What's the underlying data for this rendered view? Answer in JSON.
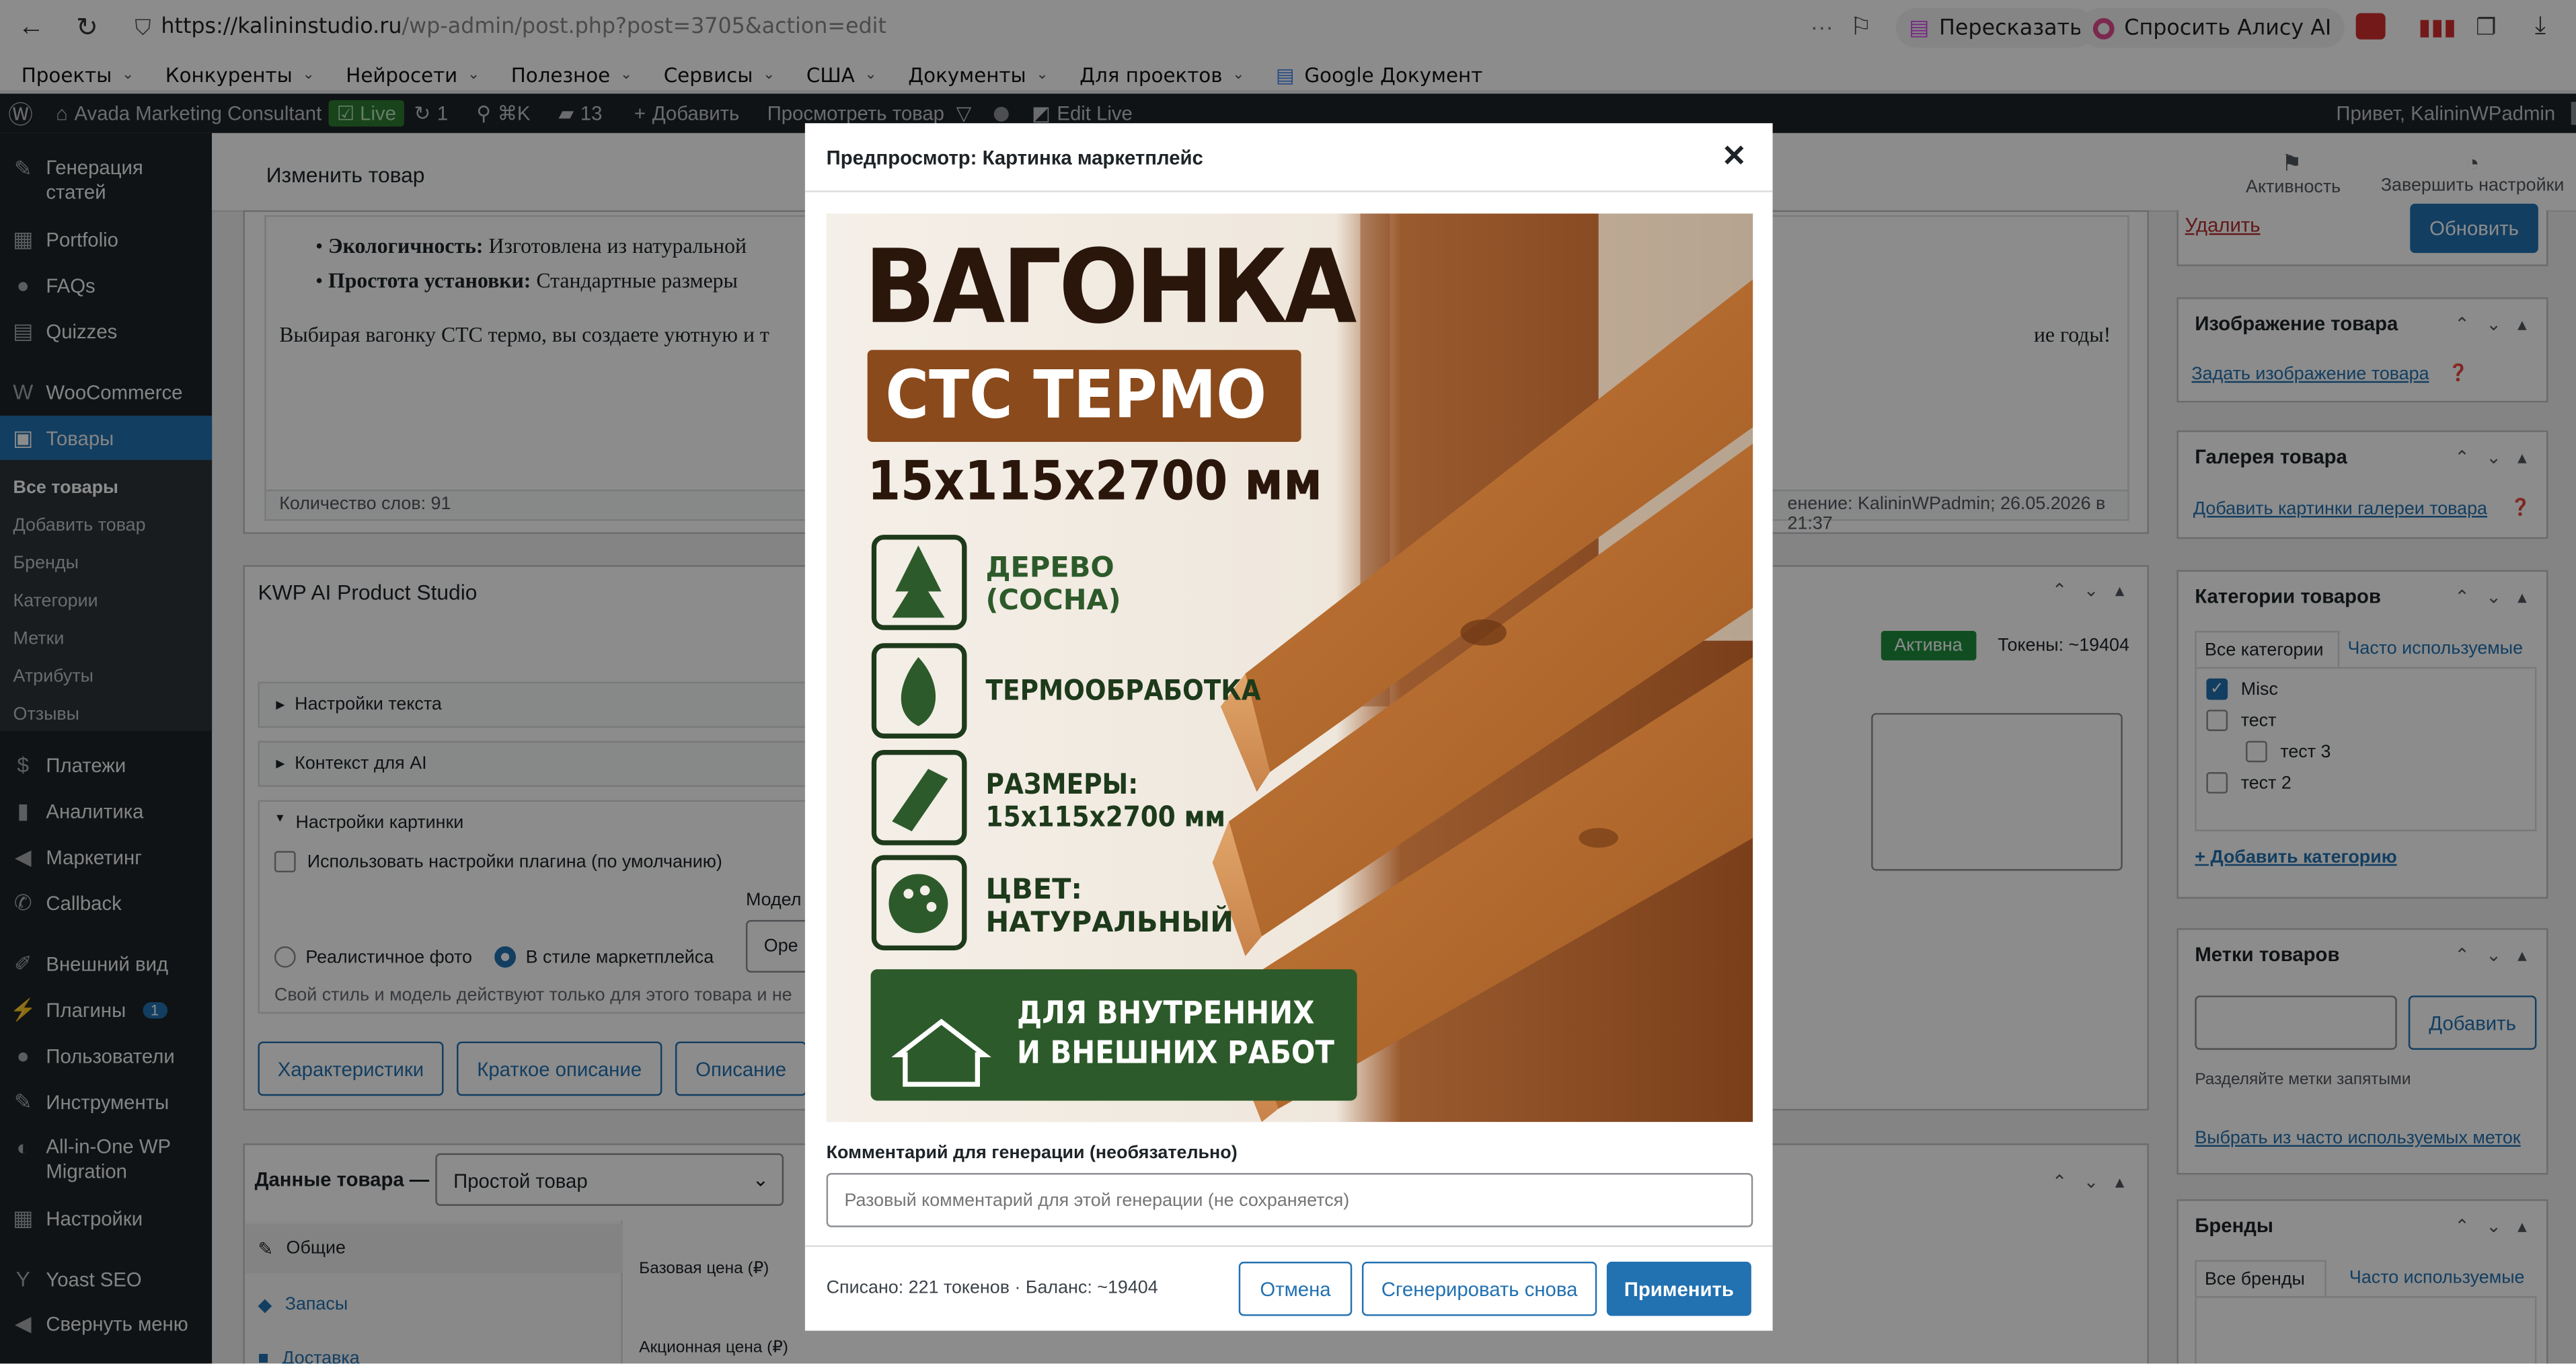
{
  "browser": {
    "url_host": "https://kalininstudio.ru",
    "url_path": "/wp-admin/post.php?post=3705&action=edit",
    "chip_retell": "Пересказать",
    "chip_alice": "Спросить Алису AI",
    "bookmarks": [
      "Проекты",
      "Конкуренты",
      "Нейросети",
      "Полезное",
      "Сервисы",
      "США",
      "Документы",
      "Для проектов",
      "Google Документ"
    ]
  },
  "adminbar": {
    "site": "Avada Marketing Consultant",
    "live": "Live",
    "updates": "1",
    "shortcut": "⌘K",
    "comments": "13",
    "add": "Добавить",
    "view": "Просмотреть товар",
    "edit_live": "Edit Live",
    "greeting": "Привет, KalininWPadmin"
  },
  "sidebar": {
    "items": [
      "Генерация статей",
      "Portfolio",
      "FAQs",
      "Quizzes",
      "WooCommerce",
      "Товары",
      "Платежи",
      "Аналитика",
      "Маркетинг",
      "Callback",
      "Внешний вид",
      "Плагины",
      "Пользователи",
      "Инструменты",
      "All-in-One WP Migration",
      "Настройки",
      "Yoast SEO",
      "Свернуть меню"
    ],
    "plugins_badge": "1",
    "subitems": [
      "Все товары",
      "Добавить товар",
      "Бренды",
      "Категории",
      "Метки",
      "Атрибуты",
      "Отзывы"
    ]
  },
  "header": {
    "title": "Изменить товар",
    "activity": "Активность",
    "finish": "Завершить настройки"
  },
  "editor": {
    "line1_bold": "Экологичность:",
    "line1_text": "Изготовлена из натуральной",
    "line2_bold": "Простота установки:",
    "line2_text": "Стандартные размеры",
    "para_start": "Выбирая вагонку СТС термо, вы создаете уютную и т",
    "para_end": "ие годы!",
    "word_count": "Количество слов: 91",
    "last_edit": "енение: KalininWPadmin; 26.05.2026 в 21:37"
  },
  "ai_studio": {
    "title": "KWP AI Product Studio",
    "status": "Активна",
    "tokens": "Токены: ~19404",
    "sec_text": "Настройки текста",
    "sec_ctx": "Контекст для AI",
    "sec_img": "Настройки картинки",
    "use_defaults": "Использовать настройки плагина (по умолчанию)",
    "model_label": "Модел",
    "model_value": "Оре",
    "radio_real": "Реалистичное фото",
    "radio_market": "В стиле маркетплейса",
    "note": "Свой стиль и модель действуют только для этого товара и не",
    "btn_chars": "Характеристики",
    "btn_short": "Краткое описание",
    "btn_desc": "Описание"
  },
  "product_data": {
    "title": "Данные товара —",
    "type": "Простой товар",
    "tabs": [
      "Общие",
      "Запасы",
      "Доставка"
    ],
    "base_price": "Базовая цена (₽)",
    "sale_price": "Акционная цена (₽)"
  },
  "right": {
    "delete": "Удалить",
    "update": "Обновить",
    "image_title": "Изображение товара",
    "set_image": "Задать изображение товара",
    "gallery_title": "Галерея товара",
    "add_gallery": "Добавить картинки галереи товара",
    "cats_title": "Категории товаров",
    "cats_tab_all": "Все категории",
    "cats_tab_pop": "Часто используемые",
    "cats": [
      {
        "label": "Misc",
        "checked": true
      },
      {
        "label": "тест",
        "checked": false
      },
      {
        "label": "тест 3",
        "checked": false
      },
      {
        "label": "тест 2",
        "checked": false
      }
    ],
    "add_cat": "+ Добавить категорию",
    "tags_title": "Метки товаров",
    "tags_add": "Добавить",
    "tags_hint": "Разделяйте метки запятыми",
    "tags_pick": "Выбрать из часто используемых меток",
    "brands_title": "Бренды",
    "brands_tab_all": "Все бренды",
    "brands_tab_pop": "Часто используемые"
  },
  "modal": {
    "title": "Предпросмотр: Картинка маркетплейс",
    "comment_label": "Комментарий для генерации (необязательно)",
    "comment_placeholder": "Разовый комментарий для этой генерации (не сохраняется)",
    "spent": "Списано: 221 токенов · Баланс: ~19404",
    "cancel": "Отмена",
    "regen": "Сгенерировать снова",
    "apply": "Применить"
  },
  "poster": {
    "headline": "ВАГОНКА",
    "badge": "СТС ТЕРМО",
    "size": "15х115х2700 мм",
    "features": [
      {
        "icon": "tree-icon",
        "text": "ДЕРЕВО\n(СОСНА)"
      },
      {
        "icon": "fire-icon",
        "text": "ТЕРМООБРАБОТКА"
      },
      {
        "icon": "board-icon",
        "text": "РАЗМЕРЫ:\n15х115х2700 мм"
      },
      {
        "icon": "palette-icon",
        "text": "ЦВЕТ:\nНАТУРАЛЬНЫЙ"
      }
    ],
    "footer": "ДЛЯ ВНУТРЕННИХ\nИ ВНЕШНИХ РАБОТ"
  },
  "colors": {
    "wp_blue": "#2271b1",
    "poster_green": "#2d5a2a",
    "poster_brown": "#8a4a1c",
    "dark": "#1d2327"
  }
}
